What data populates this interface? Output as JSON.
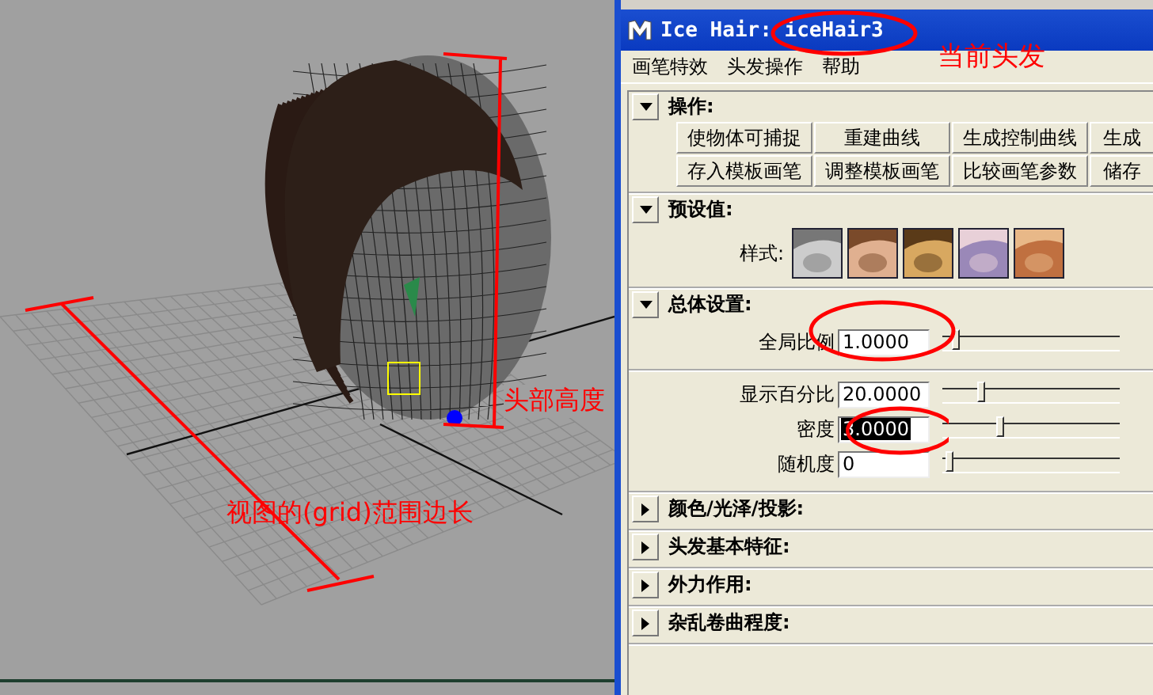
{
  "window": {
    "title": "Ice Hair: iceHair3"
  },
  "menu": [
    {
      "label": "画笔特效"
    },
    {
      "label": "头发操作"
    },
    {
      "label": "帮助"
    }
  ],
  "sections": [
    {
      "kind": "buttons",
      "title": "操作:",
      "expanded": true,
      "rows": [
        [
          "使物体可捕捉",
          "重建曲线",
          "生成控制曲线",
          "生成"
        ],
        [
          "存入模板画笔",
          "调整模板画笔",
          "比较画笔参数",
          "储存"
        ]
      ]
    },
    {
      "kind": "presets",
      "title": "预设值:",
      "expanded": true,
      "label": "样式:"
    },
    {
      "kind": "sliders",
      "title": "总体设置:",
      "expanded": true,
      "groups": [
        [
          {
            "label": "全局比例",
            "value": "1.0000",
            "selected": false,
            "level": 0.05
          }
        ],
        [
          {
            "label": "显示百分比",
            "value": "20.0000",
            "selected": false,
            "level": 0.2
          },
          {
            "label": "密度",
            "value": "3.0000",
            "selected": true,
            "level": 0.3
          },
          {
            "label": "随机度",
            "value": "0",
            "selected": false,
            "level": 0.02
          }
        ]
      ]
    },
    {
      "kind": "collapsed",
      "title": "颜色/光泽/投影:",
      "expanded": false
    },
    {
      "kind": "collapsed",
      "title": "头发基本特征:",
      "expanded": false
    },
    {
      "kind": "collapsed",
      "title": "外力作用:",
      "expanded": false
    },
    {
      "kind": "collapsed",
      "title": "杂乱卷曲程度:",
      "expanded": false
    }
  ],
  "annotations": [
    {
      "kind": "title-note",
      "text": "当前头发"
    },
    {
      "kind": "height-note",
      "text": "头部高度"
    },
    {
      "kind": "grid-note",
      "text": "视图的(grid)范围边长"
    }
  ]
}
